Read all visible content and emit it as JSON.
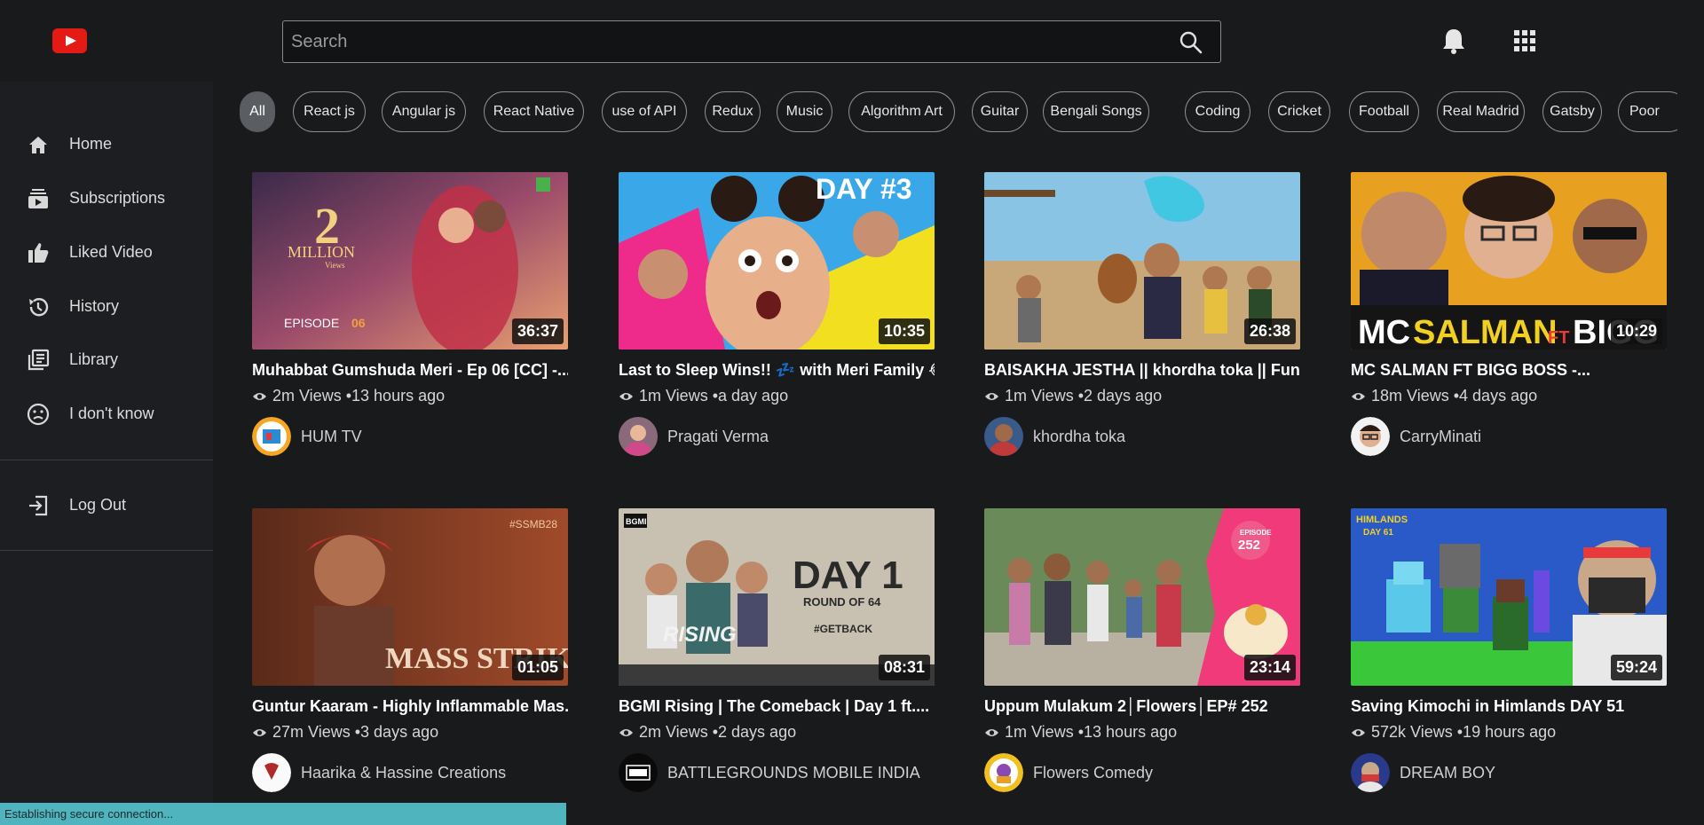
{
  "header": {
    "search_placeholder": "Search",
    "logo_icon": "youtube-logo-icon",
    "search_icon": "search-icon",
    "bell_icon": "bell-icon",
    "apps_icon": "apps-grid-icon"
  },
  "sidebar": {
    "items": [
      {
        "label": "Home",
        "icon": "home-icon"
      },
      {
        "label": "Subscriptions",
        "icon": "subscriptions-icon"
      },
      {
        "label": "Liked Video",
        "icon": "thumbs-up-icon"
      },
      {
        "label": "History",
        "icon": "history-icon"
      },
      {
        "label": "Library",
        "icon": "library-icon"
      },
      {
        "label": "I don't know",
        "icon": "confused-face-icon"
      }
    ],
    "logout": {
      "label": "Log Out",
      "icon": "logout-icon"
    }
  },
  "chips": [
    "All",
    "React js",
    "Angular js",
    "React Native",
    "use of API",
    "Redux",
    "Music",
    "Algorithm Art",
    "Guitar",
    "Bengali Songs",
    "Coding",
    "Cricket",
    "Football",
    "Real Madrid",
    "Gatsby",
    "Poor"
  ],
  "videos": [
    {
      "title": "Muhabbat Gumshuda Meri - Ep 06 [CC] -...",
      "views": "2m Views",
      "age": "•13 hours ago",
      "channel": "HUM TV",
      "duration": "36:37"
    },
    {
      "title": "Last to Sleep Wins!! 💤 with Meri Family 😂",
      "views": "1m Views",
      "age": "•a day ago",
      "channel": "Pragati Verma",
      "duration": "10:35"
    },
    {
      "title": "BAISAKHA JESTHA || khordha toka || Fun...",
      "views": "1m Views",
      "age": "•2 days ago",
      "channel": "khordha toka",
      "duration": "26:38"
    },
    {
      "title": "MC SALMAN FT BIGG BOSS -...",
      "views": "18m Views",
      "age": "•4 days ago",
      "channel": "CarryMinati",
      "duration": "10:29"
    },
    {
      "title": "Guntur Kaaram - Highly Inflammable Mas...",
      "views": "27m Views",
      "age": "•3 days ago",
      "channel": "Haarika & Hassine Creations",
      "duration": "01:05"
    },
    {
      "title": "BGMI Rising | The Comeback | Day 1 ft....",
      "views": "2m Views",
      "age": "•2 days ago",
      "channel": "BATTLEGROUNDS MOBILE INDIA",
      "duration": "08:31"
    },
    {
      "title": "Uppum Mulakum 2│Flowers│EP# 252",
      "views": "1m Views",
      "age": "•13 hours ago",
      "channel": "Flowers Comedy",
      "duration": "23:14"
    },
    {
      "title": "Saving Kimochi in Himlands DAY 51",
      "views": "572k Views",
      "age": "•19 hours ago",
      "channel": "DREAM BOY",
      "duration": "59:24"
    }
  ],
  "thumbnail_text": {
    "t1_big": "2",
    "t1_small": "MILLION",
    "t1_views": "Views",
    "t1_episode": "EPISODE",
    "t1_ep_num": "06",
    "t2_day": "DAY #3",
    "t4_mc": "MC",
    "t4_salman": "SALMAN",
    "t4_ft": "FT",
    "t4_bigg": "BIGG BO",
    "t5_mass": "MASS STRIKE",
    "t5_tag": "#SSMB28",
    "t6_day": "DAY 1",
    "t6_round": "ROUND OF 64",
    "t6_tag": "#GETBACK",
    "t6_rising": "RISING",
    "t6_logo": "BGMI",
    "t7_episode": "EPISODE",
    "t7_num": "252",
    "t8_him": "HIMLANDS",
    "t8_day": "DAY 61"
  },
  "status_bar": "Establishing secure connection..."
}
